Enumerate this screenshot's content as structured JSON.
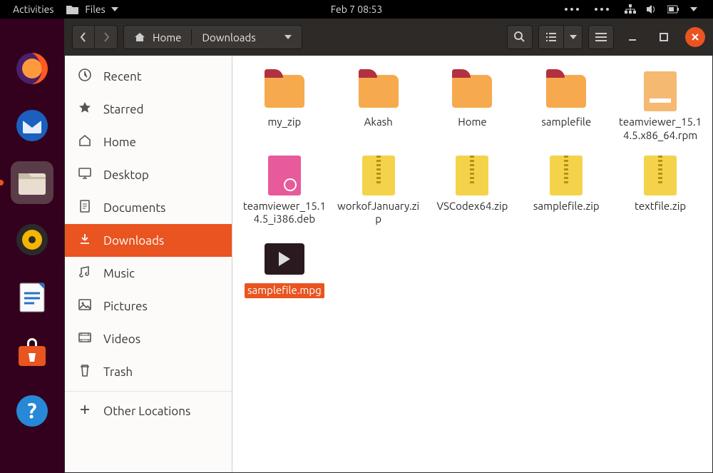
{
  "panel": {
    "activities": "Activities",
    "app_name": "Files",
    "clock": "Feb 7  08:53"
  },
  "dock": {
    "apps": [
      {
        "name": "firefox"
      },
      {
        "name": "thunderbird"
      },
      {
        "name": "files",
        "focused": true
      },
      {
        "name": "rhythmbox"
      },
      {
        "name": "libreoffice-writer"
      },
      {
        "name": "software"
      },
      {
        "name": "help"
      }
    ]
  },
  "fm": {
    "breadcrumb": {
      "home": "Home",
      "current": "Downloads"
    },
    "sidebar": [
      {
        "icon": "recent",
        "label": "Recent"
      },
      {
        "icon": "starred",
        "label": "Starred"
      },
      {
        "icon": "home",
        "label": "Home"
      },
      {
        "icon": "desktop",
        "label": "Desktop"
      },
      {
        "icon": "documents",
        "label": "Documents"
      },
      {
        "icon": "downloads",
        "label": "Downloads",
        "active": true
      },
      {
        "icon": "music",
        "label": "Music"
      },
      {
        "icon": "pictures",
        "label": "Pictures"
      },
      {
        "icon": "videos",
        "label": "Videos"
      },
      {
        "icon": "trash",
        "label": "Trash"
      },
      {
        "separator": true
      },
      {
        "icon": "other",
        "label": "Other Locations"
      }
    ],
    "files": [
      {
        "type": "folder",
        "label": "my_zip"
      },
      {
        "type": "folder",
        "label": "Akash"
      },
      {
        "type": "folder",
        "label": "Home"
      },
      {
        "type": "folder",
        "label": "samplefile"
      },
      {
        "type": "rpm",
        "label": "teamviewer_15.14.5.x86_64.rpm"
      },
      {
        "type": "deb",
        "label": "teamviewer_15.14.5_i386.deb"
      },
      {
        "type": "zip",
        "label": "workofJanuary.zip"
      },
      {
        "type": "zip",
        "label": "VSCodex64.zip"
      },
      {
        "type": "zip",
        "label": "samplefile.zip"
      },
      {
        "type": "zip",
        "label": "textfile.zip"
      },
      {
        "type": "video",
        "label": "samplefile.mpg",
        "selected": true
      }
    ]
  }
}
